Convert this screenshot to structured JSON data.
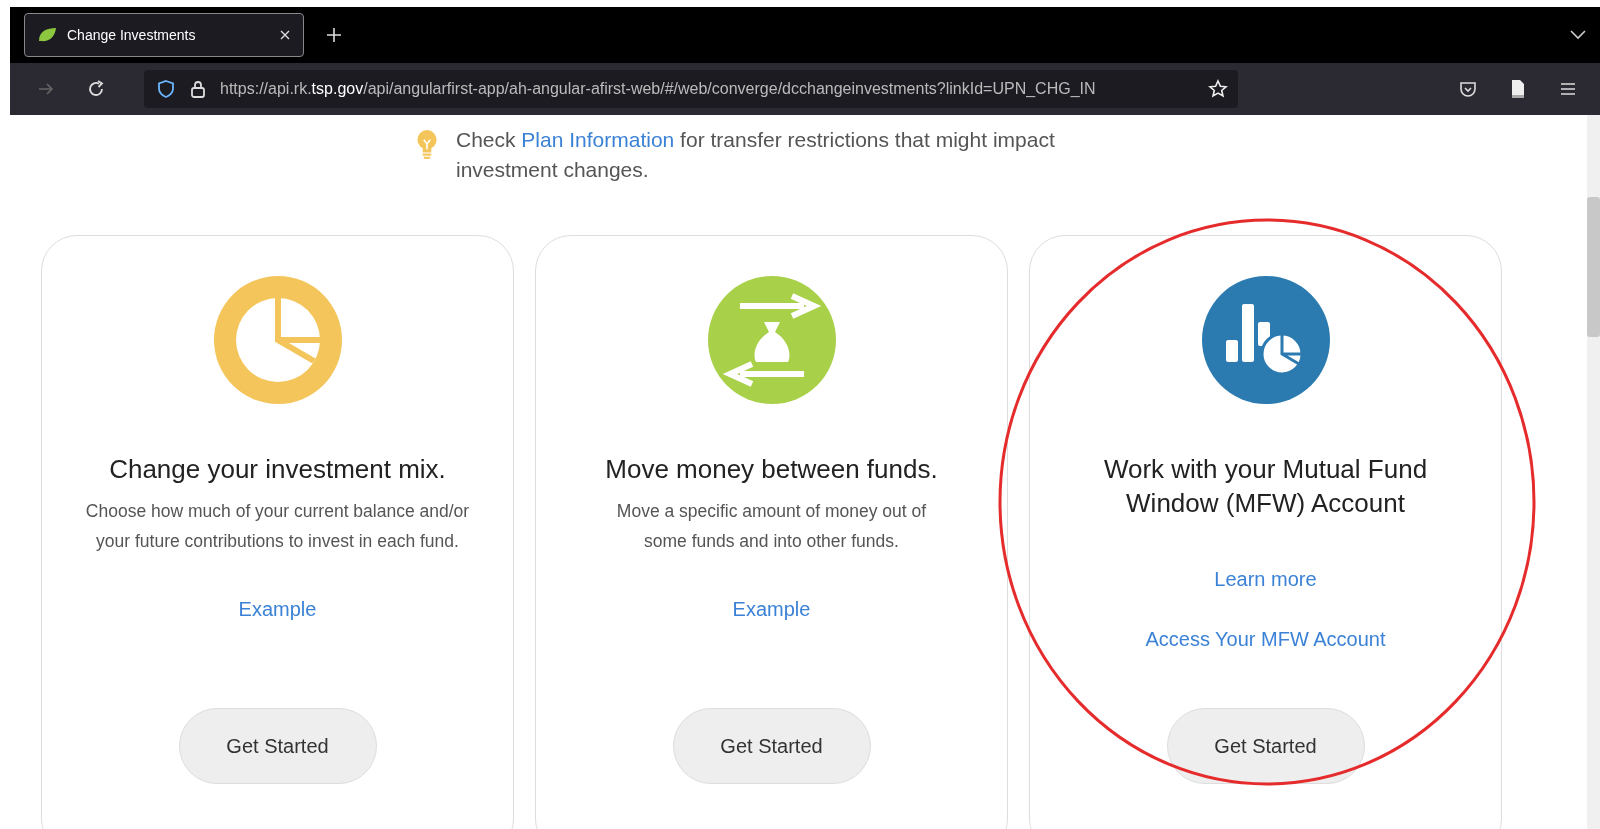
{
  "browser": {
    "tab": {
      "title": "Change Investments",
      "selected": true
    },
    "address": {
      "prefix": "https://api.rk.",
      "domain": "tsp.gov",
      "rest": "/api/angularfirst-app/ah-angular-afirst-web/#/web/converge/dcchangeinvestments?linkId=UPN_CHG_IN"
    }
  },
  "notice": {
    "before": "Check",
    "link": "Plan Information",
    "after": "for transfer restrictions that might impact investment changes."
  },
  "cards": [
    {
      "kind": "pie",
      "title": "Change your investment mix.",
      "description": "Choose how much of your current balance and/or your future contributions to invest in each fund.",
      "links": [
        "Example"
      ],
      "button": "Get Started"
    },
    {
      "kind": "transfer",
      "title": "Move money between funds.",
      "description": "Move a specific amount of money out of some funds and into other funds.",
      "links": [
        "Example"
      ],
      "button": "Get Started"
    },
    {
      "kind": "charts",
      "title": "Work with your Mutual Fund Window (MFW) Account",
      "links": [
        "Learn more",
        "Access Your MFW Account"
      ],
      "button": "Get Started"
    }
  ]
}
